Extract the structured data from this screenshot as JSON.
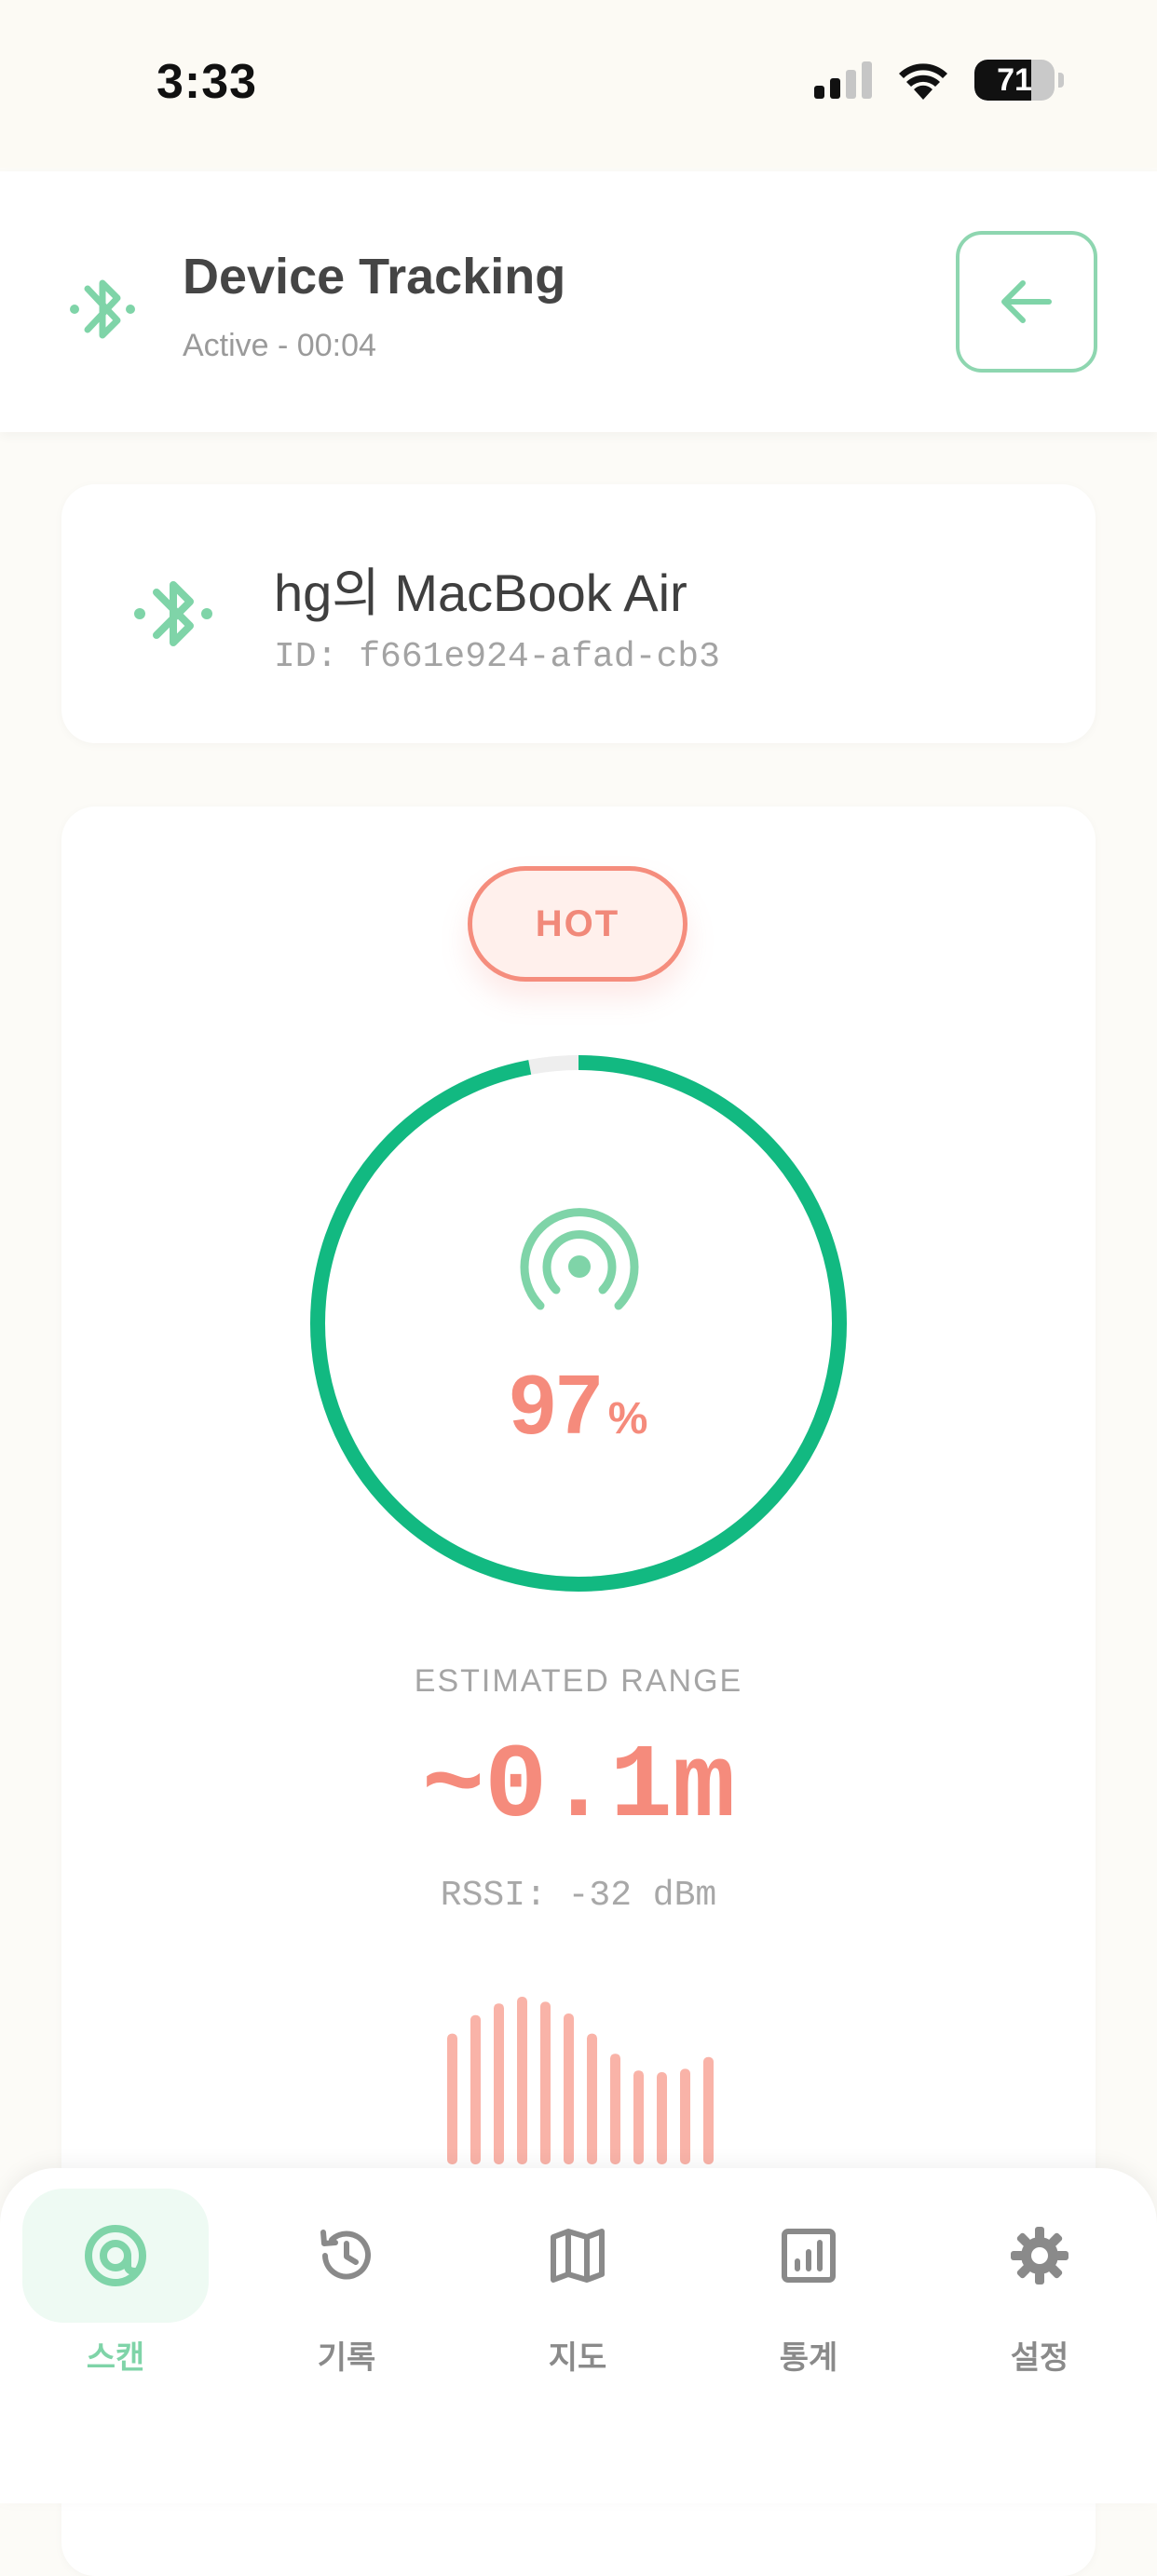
{
  "status_bar": {
    "time": "3:33",
    "battery": 71
  },
  "header": {
    "title": "Device Tracking",
    "subtitle": "Active - 00:04",
    "icon": "bluetooth-icon",
    "back_icon": "arrow-left-icon"
  },
  "device": {
    "name": "hg의 MacBook Air",
    "id": "ID: f661e924-afad-cb3",
    "icon": "bluetooth-icon"
  },
  "signal": {
    "badge": "HOT",
    "percent_value": "97",
    "percent_symbol": "%",
    "strength_fraction": 0.97,
    "range_label": "ESTIMATED RANGE",
    "range_value": "~0.1m",
    "rssi": "RSSI: -32 dBm",
    "history_levels": [
      0.78,
      0.89,
      0.96,
      1.0,
      0.97,
      0.9,
      0.78,
      0.66,
      0.56,
      0.55,
      0.57,
      0.64
    ]
  },
  "colors": {
    "accent_green": "#12b981",
    "light_green": "#8ed6b0",
    "hot_coral": "#f58b7c",
    "bar_coral": "#f9b3a8",
    "nav_gray": "#8a8a8a"
  },
  "nav": {
    "items": [
      {
        "label": "스캔",
        "icon": "scan-target-icon",
        "active": true
      },
      {
        "label": "기록",
        "icon": "history-icon",
        "active": false
      },
      {
        "label": "지도",
        "icon": "map-icon",
        "active": false
      },
      {
        "label": "통계",
        "icon": "stats-chart-icon",
        "active": false
      },
      {
        "label": "설정",
        "icon": "gear-icon",
        "active": false
      }
    ]
  }
}
